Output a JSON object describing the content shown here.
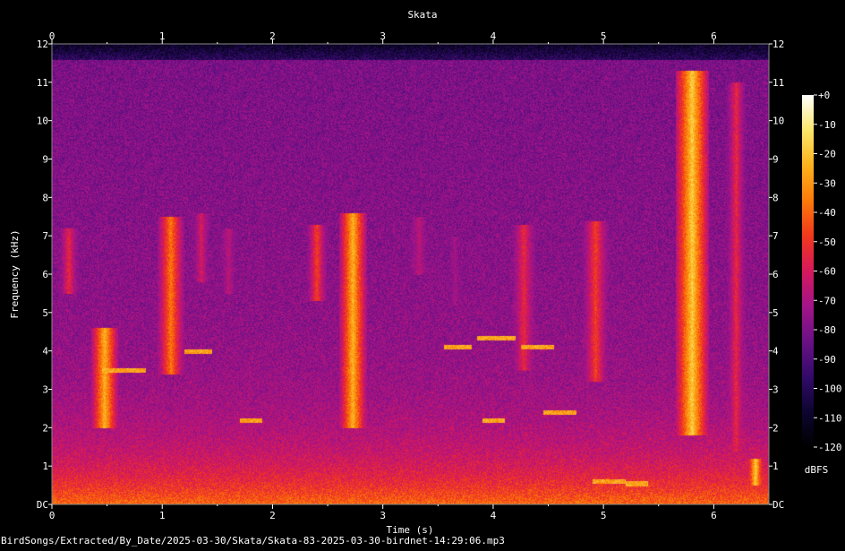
{
  "chart_data": {
    "type": "heatmap",
    "title": "Skata",
    "xlabel": "Time (s)",
    "ylabel": "Frequency (kHz)",
    "xlim": [
      0,
      6.5
    ],
    "ylim": [
      0,
      12
    ],
    "x_ticks": [
      "0",
      "1",
      "2",
      "3",
      "4",
      "5",
      "6"
    ],
    "y_ticks": [
      "DC",
      "1",
      "2",
      "3",
      "4",
      "5",
      "6",
      "7",
      "8",
      "9",
      "10",
      "11",
      "12"
    ],
    "colorbar": {
      "label": "dBFS",
      "range": [
        -120,
        0
      ],
      "ticks": [
        "+0",
        "-10",
        "-20",
        "-30",
        "-40",
        "-50",
        "-60",
        "-70",
        "-80",
        "-90",
        "-100",
        "-110",
        "-120"
      ],
      "colormap": [
        "#000000",
        "#0d0530",
        "#330a6a",
        "#6a1185",
        "#a3148a",
        "#d6185c",
        "#f2381c",
        "#fb7a0a",
        "#fcb21c",
        "#fbe66a",
        "#ffffff"
      ]
    },
    "noise_floor_top_khz": 11.6,
    "signal_events": [
      {
        "t_start": 0.05,
        "t_end": 0.25,
        "f_low": 5.5,
        "f_high": 7.2,
        "level": 0.55
      },
      {
        "t_start": 0.35,
        "t_end": 0.6,
        "f_low": 2.0,
        "f_high": 4.6,
        "level": 0.8
      },
      {
        "t_start": 0.95,
        "t_end": 1.2,
        "f_low": 3.4,
        "f_high": 7.5,
        "level": 0.7
      },
      {
        "t_start": 1.25,
        "t_end": 1.45,
        "f_low": 5.8,
        "f_high": 7.6,
        "level": 0.5
      },
      {
        "t_start": 1.5,
        "t_end": 1.7,
        "f_low": 5.5,
        "f_high": 7.2,
        "level": 0.45
      },
      {
        "t_start": 2.3,
        "t_end": 2.5,
        "f_low": 5.3,
        "f_high": 7.3,
        "level": 0.6
      },
      {
        "t_start": 2.6,
        "t_end": 2.85,
        "f_low": 2.0,
        "f_high": 7.6,
        "level": 0.8
      },
      {
        "t_start": 3.2,
        "t_end": 3.45,
        "f_low": 6.0,
        "f_high": 7.5,
        "level": 0.45
      },
      {
        "t_start": 3.55,
        "t_end": 3.75,
        "f_low": 5.2,
        "f_high": 7.0,
        "level": 0.4
      },
      {
        "t_start": 4.15,
        "t_end": 4.4,
        "f_low": 3.5,
        "f_high": 7.3,
        "level": 0.55
      },
      {
        "t_start": 4.8,
        "t_end": 5.05,
        "f_low": 3.2,
        "f_high": 7.4,
        "level": 0.6
      },
      {
        "t_start": 5.65,
        "t_end": 5.95,
        "f_low": 1.8,
        "f_high": 11.3,
        "level": 0.85
      },
      {
        "t_start": 6.1,
        "t_end": 6.3,
        "f_low": 1.4,
        "f_high": 11.0,
        "level": 0.55
      },
      {
        "t_start": 6.3,
        "t_end": 6.45,
        "f_low": 0.5,
        "f_high": 1.2,
        "level": 0.85
      }
    ],
    "tonal_lines": [
      {
        "t_start": 0.45,
        "t_end": 0.85,
        "f": 3.5
      },
      {
        "t_start": 1.2,
        "t_end": 1.45,
        "f": 4.0
      },
      {
        "t_start": 3.55,
        "t_end": 3.8,
        "f": 4.1
      },
      {
        "t_start": 3.85,
        "t_end": 4.2,
        "f": 4.35
      },
      {
        "t_start": 3.9,
        "t_end": 4.1,
        "f": 2.2
      },
      {
        "t_start": 4.25,
        "t_end": 4.55,
        "f": 4.1
      },
      {
        "t_start": 4.45,
        "t_end": 4.75,
        "f": 2.4
      },
      {
        "t_start": 4.9,
        "t_end": 5.2,
        "f": 0.6
      },
      {
        "t_start": 5.2,
        "t_end": 5.4,
        "f": 0.55
      },
      {
        "t_start": 1.7,
        "t_end": 1.9,
        "f": 2.2
      }
    ]
  },
  "footer": {
    "file_path": "BirdSongs/Extracted/By_Date/2025-03-30/Skata/Skata-83-2025-03-30-birdnet-14:29:06.mp3"
  }
}
